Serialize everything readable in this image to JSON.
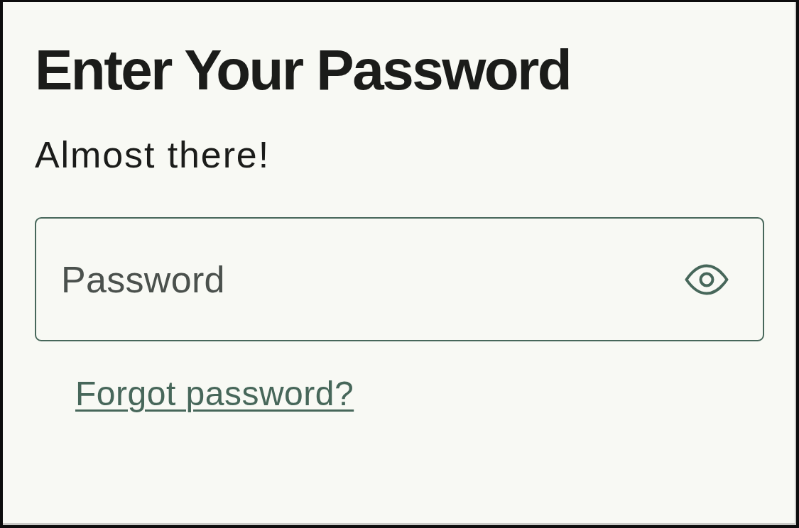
{
  "title": "Enter Your Password",
  "subtitle": "Almost there!",
  "password_field": {
    "placeholder": "Password"
  },
  "forgot_link": "Forgot password?"
}
